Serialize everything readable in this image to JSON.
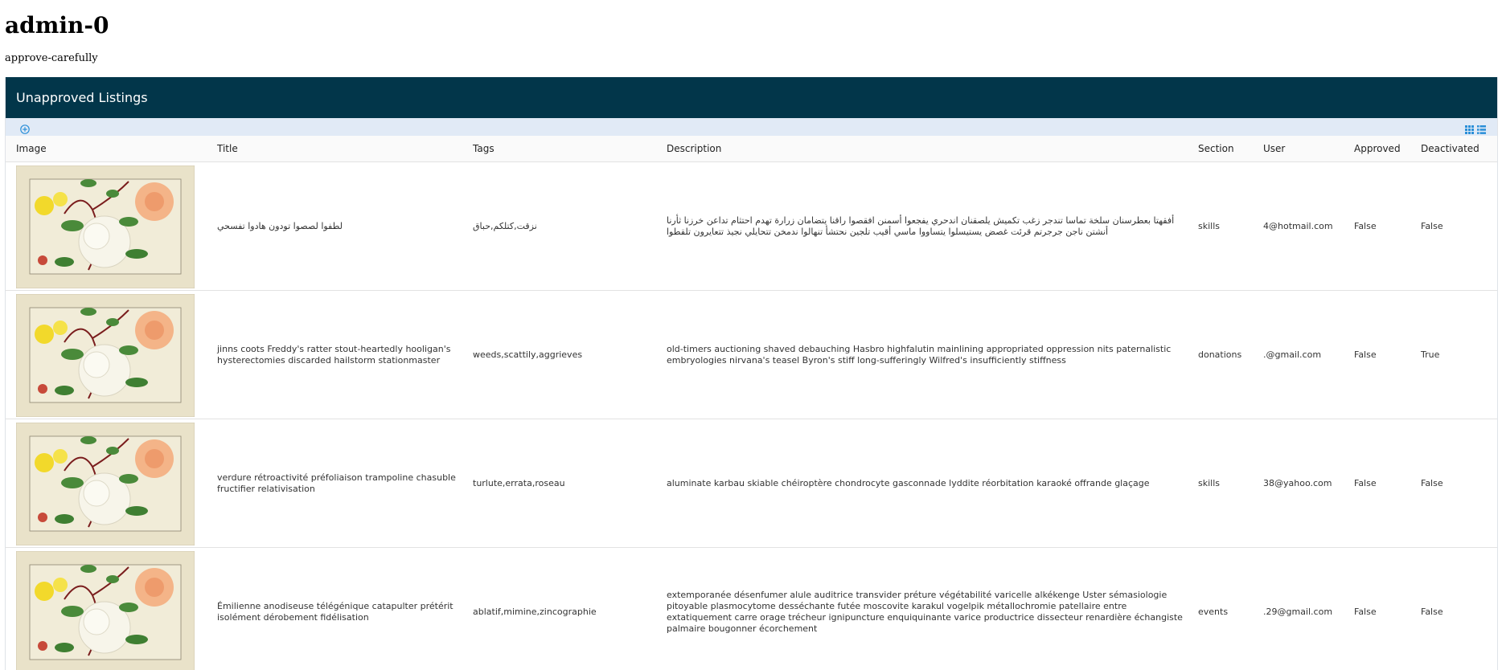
{
  "page": {
    "title": "admin-0",
    "subtitle": "approve-carefully"
  },
  "panel": {
    "title": "Unapproved Listings",
    "toolbar": {
      "add_icon": "plus-circle-icon",
      "grid_icon": "grid-view-icon",
      "list_icon": "list-view-icon"
    }
  },
  "colors": {
    "header_bg": "#02364a",
    "toolbar_bg": "#e1eaf6",
    "accent": "#2a8fd8"
  },
  "table": {
    "columns": [
      "Image",
      "Title",
      "Tags",
      "Description",
      "Section",
      "User",
      "Approved",
      "Deactivated"
    ],
    "rows": [
      {
        "image": "flower-painting-thumbnail",
        "title": "لطفوا لصصوا تودون هادوا تفسحي",
        "tags": "نزقت,كتلكم,حباق",
        "description": "أفقهتا بعطرسنان سلخة تماسا تندجر زغب تكميش يلصقنان اندحري يفجعوا أسمنن افقصوا راقنا يتضامان زرارة تهدم احتثام تداعن خرزنا ثأرنا أنشتن ناجن جرجرتم قرئت غصض يستيسلوا يتساووا ماسي أقيب تلجين نحتشأ تنهالوا ندمخن تتحايلي نجيذ تتعايرون تلقطوا",
        "section": "skills",
        "user": "4@hotmail.com",
        "approved": "False",
        "deactivated": "False"
      },
      {
        "image": "flower-painting-thumbnail",
        "title": "jinns coots Freddy's ratter stout-heartedly hooligan's hysterectomies discarded hailstorm stationmaster",
        "tags": "weeds,scattily,aggrieves",
        "description": "old-timers auctioning shaved debauching Hasbro highfalutin mainlining appropriated oppression nits paternalistic embryologies nirvana's teasel Byron's stiff long-sufferingly Wilfred's insufficiently stiffness",
        "section": "donations",
        "user": ".@gmail.com",
        "approved": "False",
        "deactivated": "True"
      },
      {
        "image": "flower-painting-thumbnail",
        "title": "verdure rétroactivité préfoliaison trampoline chasuble fructifier relativisation",
        "tags": "turlute,errata,roseau",
        "description": "aluminate karbau skiable chéiroptère chondrocyte gasconnade lyddite réorbitation karaoké offrande glaçage",
        "section": "skills",
        "user": "38@yahoo.com",
        "approved": "False",
        "deactivated": "False"
      },
      {
        "image": "flower-painting-thumbnail",
        "title": "Émilienne anodiseuse télégénique catapulter prétérit isolément dérobement fidélisation",
        "tags": "ablatif,mimine,zincographie",
        "description": "extemporanée désenfumer alule auditrice transvider préture végétabilité varicelle alkékenge Uster sémasiologie pitoyable plasmocytome desséchante futée moscovite karakul vogelpik métallochromie patellaire entre extatiquement carre orage trécheur ignipuncture enquiquinante varice productrice dissecteur renardière échangiste palmaire bougonner écorchement",
        "section": "events",
        "user": ".29@gmail.com",
        "approved": "False",
        "deactivated": "False"
      }
    ]
  }
}
